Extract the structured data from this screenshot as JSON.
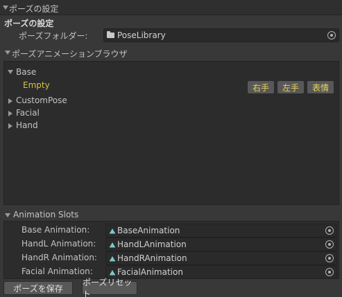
{
  "header": {
    "title": "ポーズの設定"
  },
  "settings": {
    "section_title": "ポーズの設定",
    "folder_label": "ポーズフォルダー:",
    "folder_value": "PoseLibrary"
  },
  "browser": {
    "title": "ポーズアニメーションブラウザ",
    "tree": {
      "base_label": "Base",
      "empty_label": "Empty",
      "custom_pose_label": "CustomPose",
      "facial_label": "Facial",
      "hand_label": "Hand"
    },
    "buttons": {
      "right_hand": "右手",
      "left_hand": "左手",
      "expression": "表情"
    }
  },
  "slots": {
    "title": "Animation Slots",
    "base": {
      "label": "Base Animation:",
      "value": "BaseAnimation"
    },
    "handl": {
      "label": "HandL Animation:",
      "value": "HandLAnimation"
    },
    "handr": {
      "label": "HandR Animation:",
      "value": "HandRAnimation"
    },
    "facial": {
      "label": "Facial Animation:",
      "value": "FacialAnimation"
    }
  },
  "footer": {
    "save_label": "ポーズを保存",
    "reset_label": "ポーズリセット"
  },
  "icons": {
    "foldout_open": "triangle-down-icon",
    "foldout_closed": "triangle-right-icon",
    "folder": "folder-icon",
    "animation_clip": "animation-clip-icon",
    "object_picker": "object-picker-icon"
  },
  "colors": {
    "background": "#383838",
    "panel": "#2c2c2c",
    "field": "#2a2a2a",
    "accent_yellow": "#d4c246",
    "icon_teal": "#7ec8c8"
  }
}
